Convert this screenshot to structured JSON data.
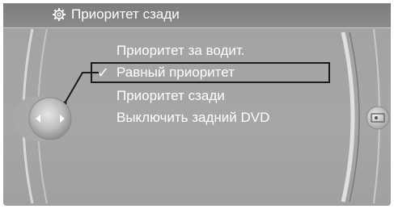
{
  "header": {
    "title": "Приоритет сзади",
    "icon": "settings-gear-icon"
  },
  "menu": {
    "items": [
      {
        "label": "Приоритет за водит.",
        "selected": false
      },
      {
        "label": "Равный приоритет",
        "selected": true
      },
      {
        "label": "Приоритет сзади",
        "selected": false
      },
      {
        "label": "Выключить задний DVD",
        "selected": false
      }
    ],
    "check_symbol": "✓"
  },
  "controller": {
    "icon": "controller-arrows-icon",
    "right_button_icon": "screen-options-icon"
  },
  "colors": {
    "background": "#a6a6a6",
    "header": "#858585",
    "text": "#ffffff",
    "selection_border": "#1a1a1a"
  }
}
